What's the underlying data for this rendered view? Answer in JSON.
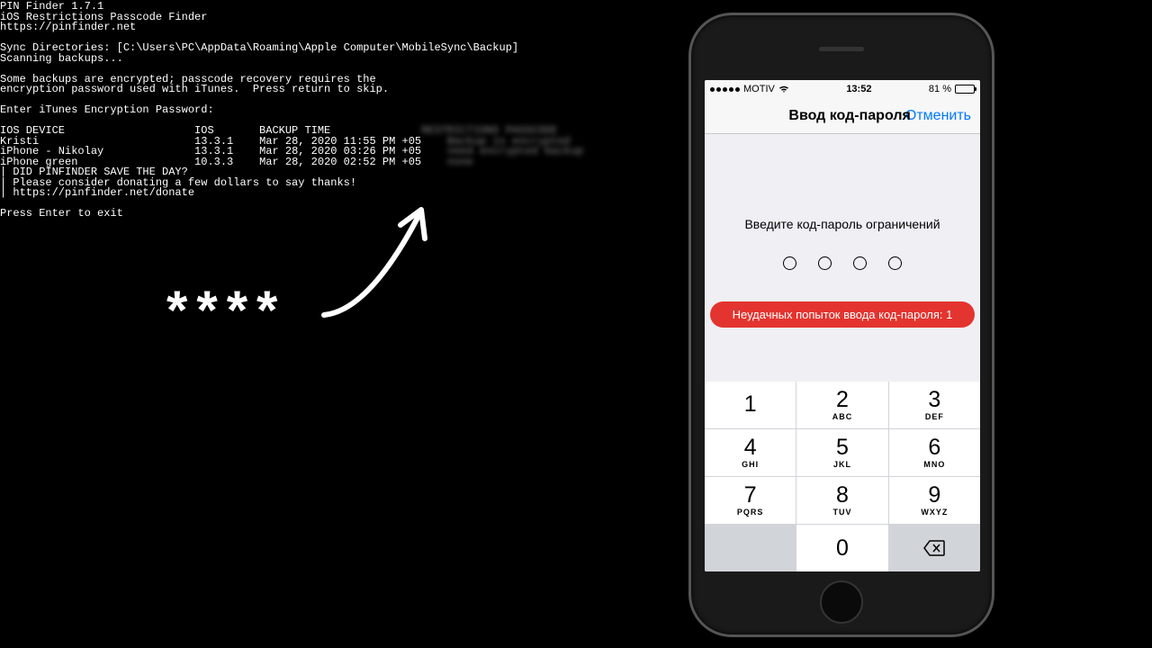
{
  "terminal": {
    "lines": "PIN Finder 1.7.1\niOS Restrictions Passcode Finder\nhttps://pinfinder.net\n\nSync Directories: [C:\\Users\\PC\\AppData\\Roaming\\Apple Computer\\MobileSync\\Backup]\nScanning backups...\n\nSome backups are encrypted; passcode recovery requires the\nencryption password used with iTunes.  Press return to skip.\n\nEnter iTunes Encryption Password:\n\n",
    "header": "IOS DEVICE                    IOS       BACKUP TIME              RESTRICTIONS PASSCODE",
    "rows": [
      {
        "device": "Kristi                        ",
        "ios": "13.3.1    ",
        "time": "Mar 28, 2020 11:55 PM +05    ",
        "blurred": "Backup is encrypted"
      },
      {
        "device": "iPhone - Nikolay              ",
        "ios": "13.3.1    ",
        "time": "Mar 28, 2020 03:26 PM +05    ",
        "blurred": "need encrypted backup"
      },
      {
        "device": "iPhone green                  ",
        "ios": "10.3.3    ",
        "time": "Mar 28, 2020 02:52 PM +05    ",
        "blurred": "none"
      }
    ],
    "footer": "\n| DID PINFINDER SAVE THE DAY?\n| Please consider donating a few dollars to say thanks!\n| https://pinfinder.net/donate\n\nPress Enter to exit"
  },
  "asterisks": "****",
  "phone": {
    "status": {
      "carrier": "MOTIV",
      "time": "13:52",
      "battery": "81 %"
    },
    "nav": {
      "title": "Ввод код-пароля",
      "cancel": "Отменить"
    },
    "prompt": "Введите код-пароль ограничений",
    "error": "Неудачных попыток ввода код-пароля: 1",
    "keys": [
      {
        "n": "1",
        "l": ""
      },
      {
        "n": "2",
        "l": "ABC"
      },
      {
        "n": "3",
        "l": "DEF"
      },
      {
        "n": "4",
        "l": "GHI"
      },
      {
        "n": "5",
        "l": "JKL"
      },
      {
        "n": "6",
        "l": "MNO"
      },
      {
        "n": "7",
        "l": "PQRS"
      },
      {
        "n": "8",
        "l": "TUV"
      },
      {
        "n": "9",
        "l": "WXYZ"
      }
    ],
    "zero": "0"
  }
}
